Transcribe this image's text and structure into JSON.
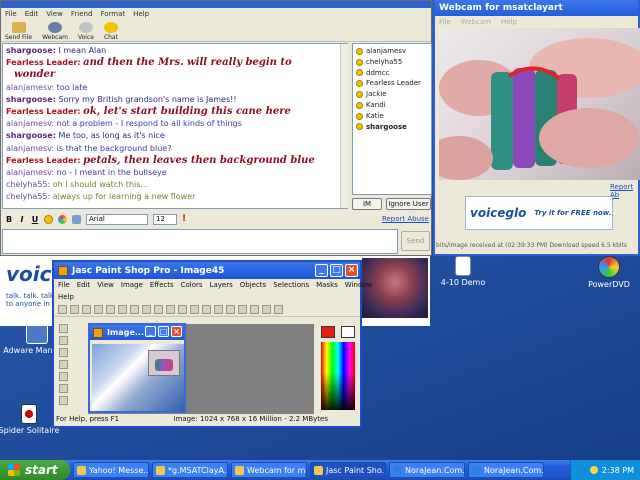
{
  "desktop": {
    "icons": [
      {
        "label": "Adware Manager",
        "name": "adware-manager"
      },
      {
        "label": "Spider Solitaire",
        "name": "spider-solitaire"
      },
      {
        "label": "4-10 Demo",
        "name": "demo"
      },
      {
        "label": "PowerDVD",
        "name": "powerdvd"
      }
    ]
  },
  "chat": {
    "menu": [
      "File",
      "Edit",
      "View",
      "Friend",
      "Format",
      "Help"
    ],
    "tools": [
      "Send File",
      "Webcam",
      "Voice",
      "Chat"
    ],
    "messages": [
      {
        "who": "shargoose:",
        "text": "I mean Alan",
        "style": "sg"
      },
      {
        "who": "Fearless Leader:",
        "text": "and then the Mrs. will really begin to",
        "style": "fl"
      },
      {
        "who": "",
        "text": "wonder",
        "style": "fl",
        "wrap": true
      },
      {
        "who": "alanjamesv:",
        "text": "too late",
        "style": "aj"
      },
      {
        "who": "shargoose:",
        "text": "Sorry my British grandson's name is James!!",
        "style": "sg"
      },
      {
        "who": "Fearless Leader:",
        "text": "ok, let's start building this cane here",
        "style": "fl"
      },
      {
        "who": "alanjamesv:",
        "text": "not a problem - I respond to all kinds of things",
        "style": "aj"
      },
      {
        "who": "shargoose:",
        "text": "Me too, as long as it's nice",
        "style": "sg"
      },
      {
        "who": "alanjamesv:",
        "text": "is that the background blue?",
        "style": "aj"
      },
      {
        "who": "Fearless Leader:",
        "text": "petals, then leaves then background blue",
        "style": "fl"
      },
      {
        "who": "alanjamesv:",
        "text": "no - I meant in the bullseye",
        "style": "aj"
      },
      {
        "who": "chelyha55:",
        "text": "oh I should watch this...",
        "style": "ch"
      },
      {
        "who": "chelyha55:",
        "text": "always up for learning a new flower",
        "style": "ch"
      }
    ],
    "buddies": [
      {
        "name": "alanjamesv",
        "bold": false
      },
      {
        "name": "chelyha55",
        "bold": false
      },
      {
        "name": "ddmcc",
        "bold": false
      },
      {
        "name": "Fearless Leader",
        "bold": false
      },
      {
        "name": "Jackie",
        "bold": false
      },
      {
        "name": "Kandi",
        "bold": false
      },
      {
        "name": "Katie",
        "bold": false
      },
      {
        "name": "shargoose",
        "bold": true
      }
    ],
    "im_label": "IM",
    "ignore_label": "Ignore User",
    "report_label": "Report Abuse",
    "font_name": "Arial",
    "font_size": "12",
    "send_label": "Send"
  },
  "webcam": {
    "title": "Webcam for msatclayart",
    "menu": [
      "File",
      "Webcam",
      "Help"
    ],
    "report_label": "Report Ab",
    "ad_logo": "voiceglo",
    "ad_tagline": "Try it for FREE now.",
    "status": "bits/image received at (02:39:33 PM)   Download speed 6.5 kbits"
  },
  "banner": {
    "logo": "voice",
    "tag1": "talk. talk. talk.",
    "tag2": "to anyone in"
  },
  "psp": {
    "title": "Jasc Paint Shop Pro - Image45",
    "menu": [
      "File",
      "Edit",
      "View",
      "Image",
      "Effects",
      "Colors",
      "Layers",
      "Objects",
      "Selections",
      "Masks",
      "Window"
    ],
    "help": "Help",
    "status_left": "For Help, press F1",
    "status_right": "Image:  1024 x 768 x 16 Million - 2.2 MBytes",
    "image_title": "Image..."
  },
  "taskbar": {
    "start": "start",
    "tasks": [
      "Yahoo! Messe...",
      "*g.MSATClayA...",
      "Webcam for m...",
      "Jasc Paint Sho...",
      "NoraJean.Com...",
      "NoraJean.Com..."
    ],
    "clock": "2:38 PM"
  }
}
